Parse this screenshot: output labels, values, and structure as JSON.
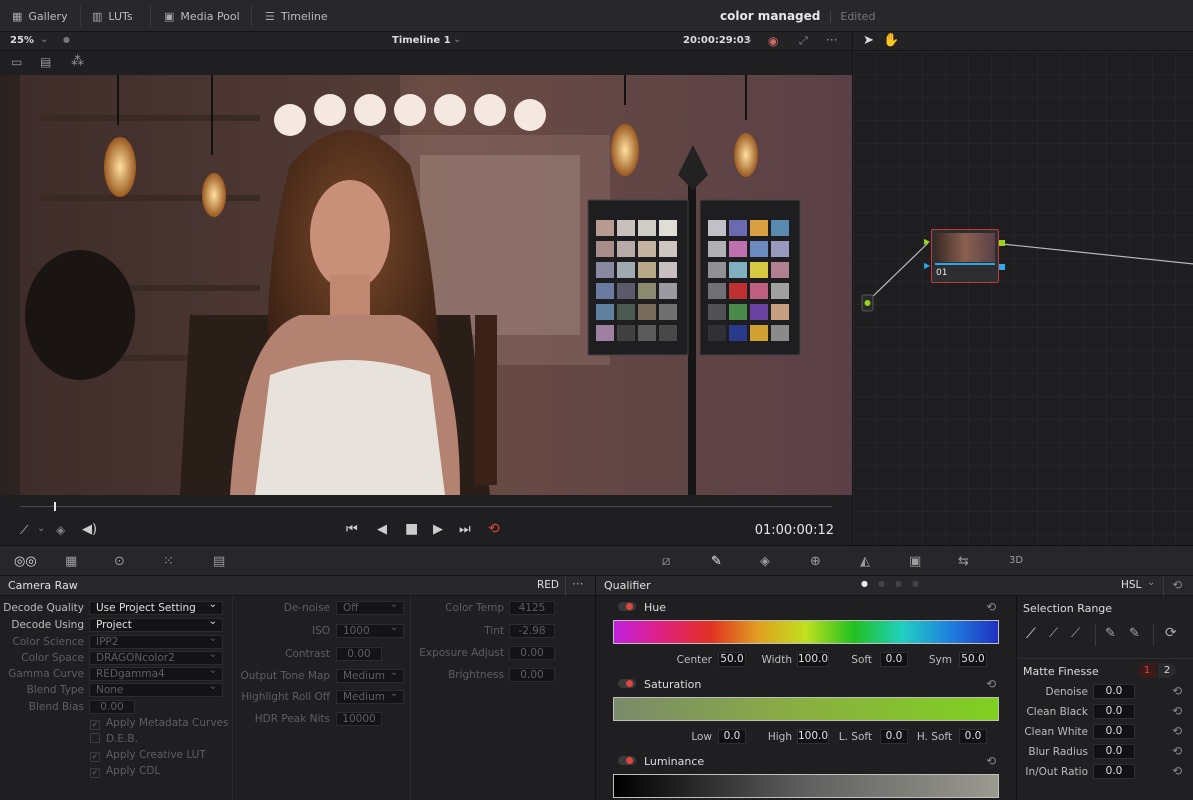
{
  "topbar": {
    "gallery": "Gallery",
    "luts": "LUTs",
    "media_pool": "Media Pool",
    "timeline": "Timeline",
    "project_title": "color managed",
    "project_status": "Edited"
  },
  "viewer": {
    "zoom": "25%",
    "timeline_name": "Timeline 1",
    "source_timecode": "20:00:29:03",
    "record_timecode": "01:00:00:12"
  },
  "node": {
    "label": "01"
  },
  "camera_raw": {
    "title": "Camera Raw",
    "format": "RED",
    "col1": [
      {
        "label": "Decode Quality",
        "value": "Use Project Setting"
      },
      {
        "label": "Decode Using",
        "value": "Project"
      },
      {
        "label": "Color Science",
        "value": "IPP2"
      },
      {
        "label": "Color Space",
        "value": "DRAGONcolor2"
      },
      {
        "label": "Gamma Curve",
        "value": "REDgamma4"
      },
      {
        "label": "Blend Type",
        "value": "None"
      },
      {
        "label": "Blend Bias",
        "value": "0.00"
      }
    ],
    "checks": [
      "Apply Metadata Curves",
      "D.E.B.",
      "Apply Creative LUT",
      "Apply CDL"
    ],
    "col2": [
      {
        "label": "De-noise",
        "value": "Off"
      },
      {
        "label": "ISO",
        "value": "1000"
      },
      {
        "label": "Contrast",
        "value": "0.00"
      },
      {
        "label": "Output Tone Map",
        "value": "Medium"
      },
      {
        "label": "Highlight Roll Off",
        "value": "Medium"
      },
      {
        "label": "HDR Peak Nits",
        "value": "10000"
      }
    ],
    "col3": [
      {
        "label": "Color Temp",
        "value": "4125"
      },
      {
        "label": "Tint",
        "value": "-2.98"
      },
      {
        "label": "Exposure Adjust",
        "value": "0.00"
      },
      {
        "label": "Brightness",
        "value": "0.00"
      }
    ]
  },
  "qualifier": {
    "title": "Qualifier",
    "mode": "HSL",
    "hue": {
      "label": "Hue",
      "center_label": "Center",
      "center": "50.0",
      "width_label": "Width",
      "width": "100.0",
      "soft_label": "Soft",
      "soft": "0.0",
      "sym_label": "Sym",
      "sym": "50.0"
    },
    "saturation": {
      "label": "Saturation",
      "low_label": "Low",
      "low": "0.0",
      "high_label": "High",
      "high": "100.0",
      "lsoft_label": "L. Soft",
      "lsoft": "0.0",
      "hsoft_label": "H. Soft",
      "hsoft": "0.0"
    },
    "luminance": {
      "label": "Luminance"
    },
    "selection_range": "Selection Range",
    "matte_finesse": "Matte Finesse",
    "matte_tabs": [
      "1",
      "2"
    ],
    "matte": [
      {
        "label": "Denoise",
        "value": "0.0"
      },
      {
        "label": "Clean Black",
        "value": "0.0"
      },
      {
        "label": "Clean White",
        "value": "0.0"
      },
      {
        "label": "Blur Radius",
        "value": "0.0"
      },
      {
        "label": "In/Out Ratio",
        "value": "0.0"
      }
    ]
  },
  "colors": {
    "accent_red": "#e0463a",
    "node_green": "#9bd21a",
    "node_blue": "#2aa8e8"
  }
}
